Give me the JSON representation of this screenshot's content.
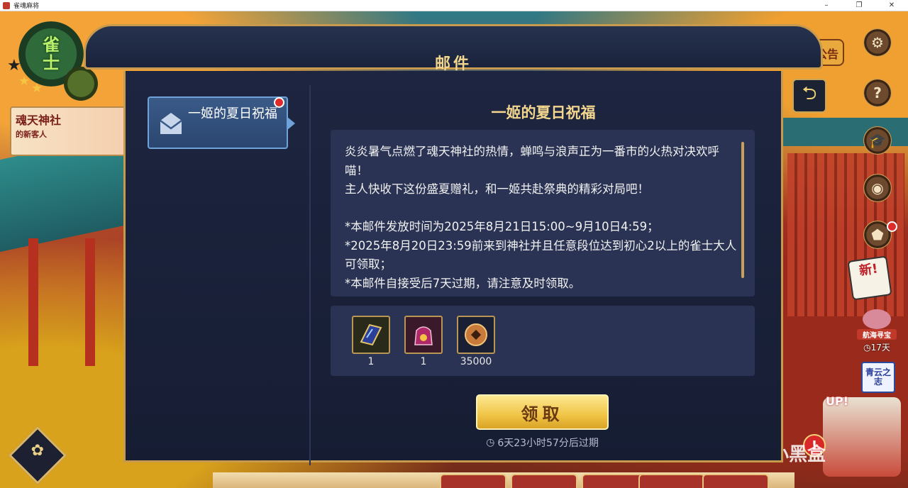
{
  "window": {
    "title": "雀魂麻将",
    "controls": [
      "–",
      "❐",
      "✕"
    ]
  },
  "hud": {
    "rank_chars": [
      "雀",
      "士"
    ],
    "shrine_banner": {
      "main": "魂天神社",
      "sub": "的新客人"
    },
    "notice_label": "公告",
    "new_badge": "新!",
    "voyage": {
      "label": "航海寻宝",
      "days": "17天"
    },
    "qingyun": "青云之志",
    "up_label": "UP!",
    "watermark": "小黑盒"
  },
  "dialog": {
    "title": "邮件",
    "list": [
      {
        "label": "一姬的夏日祝福",
        "unread": true
      }
    ],
    "detail": {
      "title": "一姬的夏日祝福",
      "paragraphs": [
        "炎炎暑气点燃了魂天神社的热情，蝉鸣与浪声正为一番市的火热对决欢呼喵！",
        "主人快收下这份盛夏赠礼，和一姬共赴祭典的精彩对局吧！",
        "",
        "*本邮件发放时间为2025年8月21日15:00~9月10日4:59；",
        "*2025年8月20日23:59前来到神社并且任意段位达到初心2以上的雀士大人可领取；",
        "*本邮件自接受后7天过期，请注意及时领取。"
      ]
    },
    "rewards": [
      {
        "icon": "fan-scroll-icon",
        "qty": "1"
      },
      {
        "icon": "gift-bag-icon",
        "qty": "1"
      },
      {
        "icon": "coin-icon",
        "qty": "35000"
      }
    ],
    "claim_label": "领取",
    "expiry_text": "6天23小时57分后过期"
  },
  "colors": {
    "gold": "#f3d68d",
    "panel": "#1d2540",
    "box": "#2a3353",
    "claim": "#f0c445",
    "unread": "#e02b2b"
  }
}
